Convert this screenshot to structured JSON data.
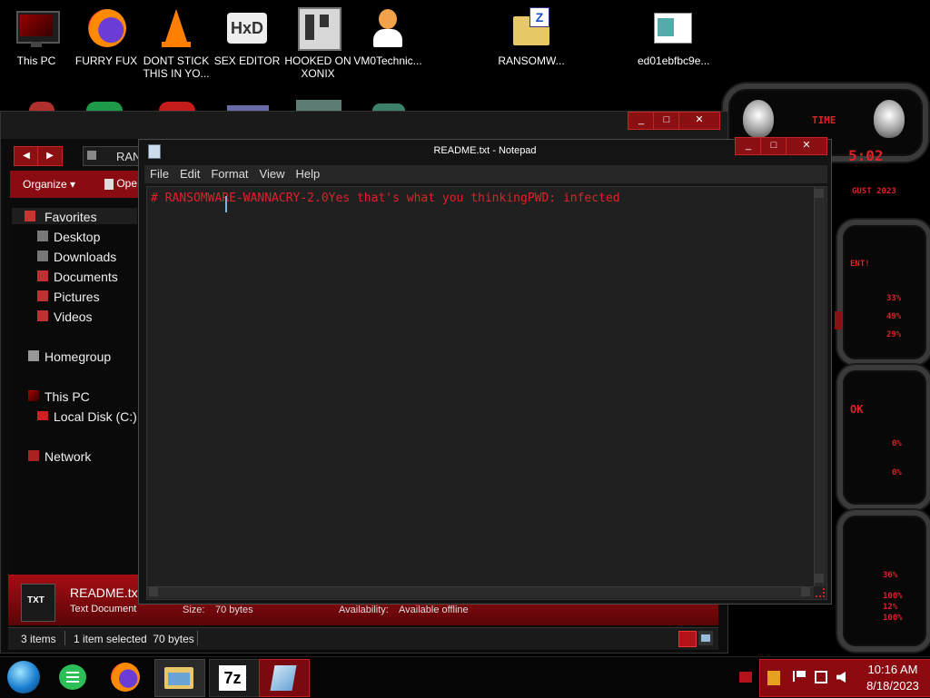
{
  "desktop": {
    "icons": [
      {
        "label": "This PC",
        "icon": "monitor-icon"
      },
      {
        "label": "FURRY FUX",
        "icon": "firefox-icon"
      },
      {
        "label": "DONT STICK THIS IN YO...",
        "icon": "vlc-cone-icon"
      },
      {
        "label": "SEX EDITOR",
        "icon": "hxd-editor-icon"
      },
      {
        "label": "HOOKED ON XONIX",
        "icon": "xonix-game-icon"
      },
      {
        "label": "VM0Technic...",
        "icon": "doctor-avatar-icon"
      },
      {
        "label": "RANSOMW...",
        "icon": "zip-folder-icon"
      },
      {
        "label": "ed01ebfbc9e...",
        "icon": "window-file-icon"
      }
    ]
  },
  "explorer": {
    "address_partial": "RAN",
    "toolbar": {
      "organize": "Organize",
      "open_partial": "Ope"
    },
    "nav": {
      "favorites": "Favorites",
      "desktop": "Desktop",
      "downloads": "Downloads",
      "documents": "Documents",
      "pictures": "Pictures",
      "videos": "Videos",
      "homegroup": "Homegroup",
      "this_pc": "This PC",
      "local_disk": "Local Disk (C:)",
      "network": "Network"
    },
    "details": {
      "filename": "README.txt",
      "filetype": "Text Document",
      "size_label": "Size:",
      "size_value": "70 bytes",
      "availability_label": "Availability:",
      "availability_value": "Available offline",
      "thumb_text": "TXT"
    },
    "status": {
      "items": "3 items",
      "selected": "1 item selected  70 bytes"
    }
  },
  "notepad": {
    "title": "README.txt - Notepad",
    "menu": [
      "File",
      "Edit",
      "Format",
      "View",
      "Help"
    ],
    "content": "# RANSOMWARE-WANNACRY-2.0Yes that's what you thinkingPWD: infected"
  },
  "gadget": {
    "header": "TIME",
    "time_partial": "5:02",
    "date_partial": "GUST 2023",
    "labels": [
      "ENT!",
      "33%",
      "49%",
      "29%",
      "OK",
      "0%",
      "0%",
      "36%",
      "100%",
      "12%",
      "100%"
    ]
  },
  "taskbar": {
    "items": [
      "start-orb-icon",
      "chat-app-icon",
      "firefox-icon",
      "file-explorer-icon",
      "7zip-icon",
      "notepad-icon"
    ],
    "clock": {
      "time": "10:16 AM",
      "date": "8/18/2023"
    }
  },
  "colors": {
    "accent": "#c21a20",
    "text_red": "#e0202a",
    "dark": "#141414"
  }
}
